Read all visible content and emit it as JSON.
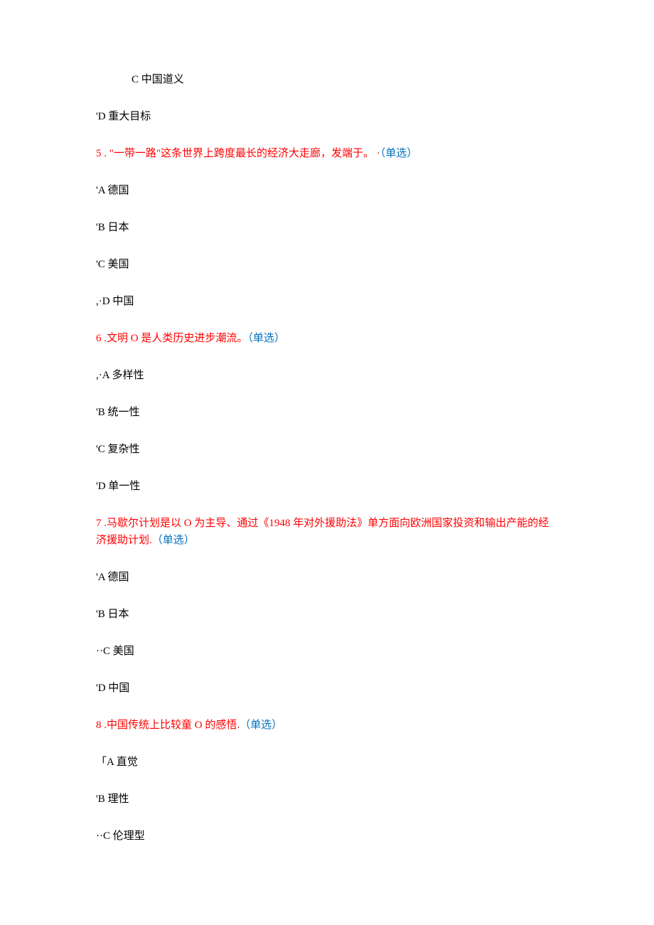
{
  "leadingOptions": {
    "c": {
      "prefix": "C ",
      "text": "中国道义"
    },
    "d": {
      "prefix": "'D ",
      "text": "重大目标"
    }
  },
  "questions": {
    "q5": {
      "num": "5",
      "separator": "  . ",
      "body": "\"一带一路\"这条世界上跨度最长的经济大走廊，发端于。",
      "mid": "  ·",
      "typeOpen": "（",
      "type": "单选",
      "typeClose": "）",
      "options": {
        "a": {
          "prefix": "'A ",
          "text": "德国"
        },
        "b": {
          "prefix": "'B ",
          "text": "日本"
        },
        "c": {
          "prefix": "'C ",
          "text": "美国"
        },
        "d": {
          "prefix": ",·D ",
          "text": "中国"
        }
      }
    },
    "q6": {
      "num": "6",
      "separator": "  .",
      "body": "文明 O 是人类历史进步潮流。",
      "mid": "",
      "typeOpen": "（",
      "type": "单选",
      "typeClose": "）",
      "options": {
        "a": {
          "prefix": ",·A ",
          "text": "多样性"
        },
        "b": {
          "prefix": "'B ",
          "text": "统一性"
        },
        "c": {
          "prefix": "'C ",
          "text": "复杂性"
        },
        "d": {
          "prefix": "'D ",
          "text": "单一性"
        }
      }
    },
    "q7": {
      "num": "7",
      "separator": "  .",
      "body": "马歇尔计划是以 O 为主导、通过《1948 年对外援助法》单方面向欧洲国家投资和输出产能的经济援助计划.",
      "mid": "",
      "typeOpen": "（",
      "type": "单选",
      "typeClose": "）",
      "options": {
        "a": {
          "prefix": "'A ",
          "text": "德国"
        },
        "b": {
          "prefix": "'B ",
          "text": "日本"
        },
        "c": {
          "prefix": "··C ",
          "text": "美国"
        },
        "d": {
          "prefix": "'D ",
          "text": "中国"
        }
      }
    },
    "q8": {
      "num": "8",
      "separator": "  .",
      "body": "中国传统上比较童 O 的感悟.",
      "mid": "",
      "typeOpen": "（",
      "type": "单选",
      "typeClose": "）",
      "options": {
        "a": {
          "prefix": "「A ",
          "text": "直觉"
        },
        "b": {
          "prefix": "'B ",
          "text": "理性"
        },
        "c": {
          "prefix": "··C ",
          "text": "伦理型"
        }
      }
    }
  }
}
